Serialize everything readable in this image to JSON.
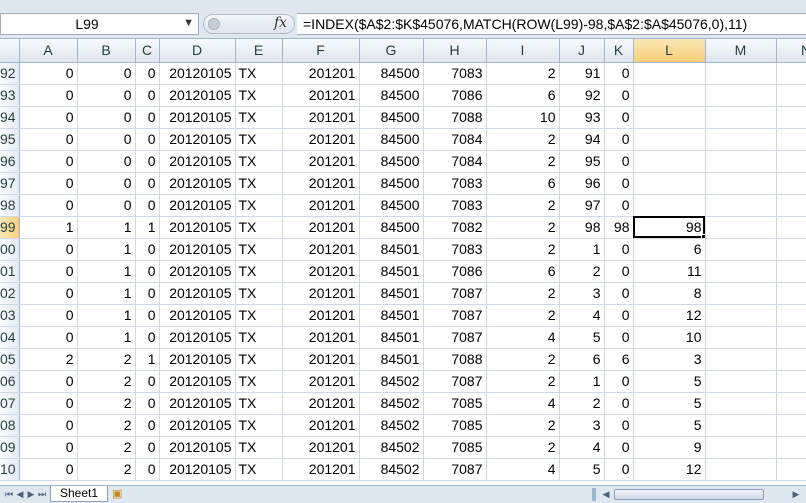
{
  "formula_bar": {
    "name_box": "L99",
    "fx_label": "fx",
    "formula": "=INDEX($A$2:$K$45076,MATCH(ROW(L99)-98,$A$2:$A$45076,0),11)"
  },
  "columns": [
    "A",
    "B",
    "C",
    "D",
    "E",
    "F",
    "G",
    "H",
    "I",
    "J",
    "K",
    "L",
    "M",
    "N"
  ],
  "selected_column": "L",
  "rows": [
    {
      "n": "92",
      "c": [
        "0",
        "0",
        "0",
        "20120105",
        "TX",
        "201201",
        "84500",
        "7083",
        "2",
        "91",
        "0",
        "",
        "",
        ""
      ]
    },
    {
      "n": "93",
      "c": [
        "0",
        "0",
        "0",
        "20120105",
        "TX",
        "201201",
        "84500",
        "7086",
        "6",
        "92",
        "0",
        "",
        "",
        ""
      ]
    },
    {
      "n": "94",
      "c": [
        "0",
        "0",
        "0",
        "20120105",
        "TX",
        "201201",
        "84500",
        "7088",
        "10",
        "93",
        "0",
        "",
        "",
        ""
      ]
    },
    {
      "n": "95",
      "c": [
        "0",
        "0",
        "0",
        "20120105",
        "TX",
        "201201",
        "84500",
        "7084",
        "2",
        "94",
        "0",
        "",
        "",
        ""
      ]
    },
    {
      "n": "96",
      "c": [
        "0",
        "0",
        "0",
        "20120105",
        "TX",
        "201201",
        "84500",
        "7084",
        "2",
        "95",
        "0",
        "",
        "",
        ""
      ]
    },
    {
      "n": "97",
      "c": [
        "0",
        "0",
        "0",
        "20120105",
        "TX",
        "201201",
        "84500",
        "7083",
        "6",
        "96",
        "0",
        "",
        "",
        ""
      ]
    },
    {
      "n": "98",
      "c": [
        "0",
        "0",
        "0",
        "20120105",
        "TX",
        "201201",
        "84500",
        "7083",
        "2",
        "97",
        "0",
        "",
        "",
        ""
      ]
    },
    {
      "n": "99",
      "c": [
        "1",
        "1",
        "1",
        "20120105",
        "TX",
        "201201",
        "84500",
        "7082",
        "2",
        "98",
        "98",
        "98",
        "",
        ""
      ]
    },
    {
      "n": "00",
      "c": [
        "0",
        "1",
        "0",
        "20120105",
        "TX",
        "201201",
        "84501",
        "7083",
        "2",
        "1",
        "0",
        "6",
        "",
        ""
      ]
    },
    {
      "n": "01",
      "c": [
        "0",
        "1",
        "0",
        "20120105",
        "TX",
        "201201",
        "84501",
        "7086",
        "6",
        "2",
        "0",
        "11",
        "",
        ""
      ]
    },
    {
      "n": "02",
      "c": [
        "0",
        "1",
        "0",
        "20120105",
        "TX",
        "201201",
        "84501",
        "7087",
        "2",
        "3",
        "0",
        "8",
        "",
        ""
      ]
    },
    {
      "n": "03",
      "c": [
        "0",
        "1",
        "0",
        "20120105",
        "TX",
        "201201",
        "84501",
        "7087",
        "2",
        "4",
        "0",
        "12",
        "",
        ""
      ]
    },
    {
      "n": "04",
      "c": [
        "0",
        "1",
        "0",
        "20120105",
        "TX",
        "201201",
        "84501",
        "7087",
        "4",
        "5",
        "0",
        "10",
        "",
        ""
      ]
    },
    {
      "n": "05",
      "c": [
        "2",
        "2",
        "1",
        "20120105",
        "TX",
        "201201",
        "84501",
        "7088",
        "2",
        "6",
        "6",
        "3",
        "",
        ""
      ]
    },
    {
      "n": "06",
      "c": [
        "0",
        "2",
        "0",
        "20120105",
        "TX",
        "201201",
        "84502",
        "7087",
        "2",
        "1",
        "0",
        "5",
        "",
        ""
      ]
    },
    {
      "n": "07",
      "c": [
        "0",
        "2",
        "0",
        "20120105",
        "TX",
        "201201",
        "84502",
        "7085",
        "4",
        "2",
        "0",
        "5",
        "",
        ""
      ]
    },
    {
      "n": "08",
      "c": [
        "0",
        "2",
        "0",
        "20120105",
        "TX",
        "201201",
        "84502",
        "7085",
        "2",
        "3",
        "0",
        "5",
        "",
        ""
      ]
    },
    {
      "n": "09",
      "c": [
        "0",
        "2",
        "0",
        "20120105",
        "TX",
        "201201",
        "84502",
        "7085",
        "2",
        "4",
        "0",
        "9",
        "",
        ""
      ]
    },
    {
      "n": "10",
      "c": [
        "0",
        "2",
        "0",
        "20120105",
        "TX",
        "201201",
        "84502",
        "7087",
        "4",
        "5",
        "0",
        "12",
        "",
        ""
      ]
    }
  ],
  "active_row": "99",
  "active_col_index": 11,
  "text_col_index": 4,
  "sheet_tabs": [
    "Sheet1"
  ],
  "nav_icons": [
    "first-sheet-icon",
    "prev-sheet-icon",
    "next-sheet-icon",
    "last-sheet-icon"
  ],
  "colors": {
    "selection_header": "#f8d07a",
    "grid_line": "#d0d7e5",
    "header_bg": "#dde4ee"
  }
}
